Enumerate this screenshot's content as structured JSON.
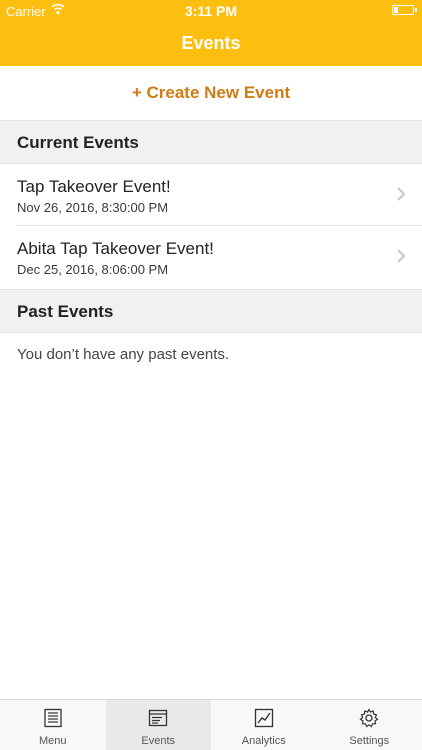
{
  "status_bar": {
    "carrier": "Carrier",
    "time": "3:11 PM"
  },
  "nav": {
    "title": "Events"
  },
  "create_button": "+ Create New Event",
  "current_events": {
    "header": "Current Events",
    "items": [
      {
        "title": "Tap Takeover Event!",
        "date": "Nov 26, 2016, 8:30:00 PM"
      },
      {
        "title": "Abita Tap Takeover Event!",
        "date": "Dec 25, 2016, 8:06:00 PM"
      }
    ]
  },
  "past_events": {
    "header": "Past Events",
    "empty_message": "You don’t have any past events."
  },
  "tabs": [
    {
      "label": "Menu",
      "icon": "menu-icon"
    },
    {
      "label": "Events",
      "icon": "events-icon",
      "active": true
    },
    {
      "label": "Analytics",
      "icon": "analytics-icon"
    },
    {
      "label": "Settings",
      "icon": "gear-icon"
    }
  ],
  "colors": {
    "accent": "#fdbf0f",
    "create_text": "#cf7c14"
  }
}
